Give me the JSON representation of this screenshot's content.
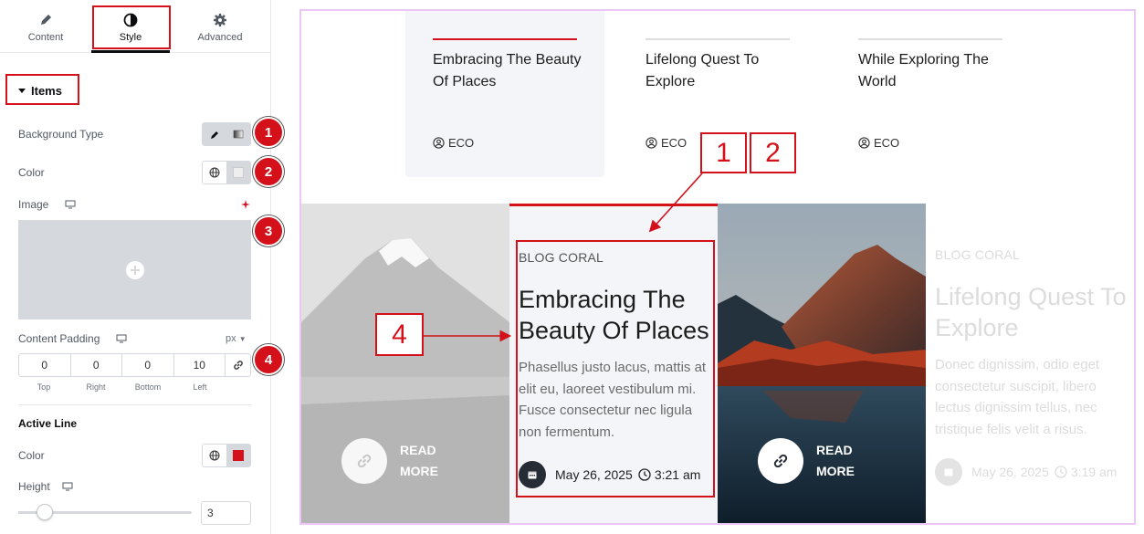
{
  "tabs": [
    {
      "label": "Content",
      "icon": "pencil-icon"
    },
    {
      "label": "Style",
      "icon": "half-circle-icon"
    },
    {
      "label": "Advanced",
      "icon": "gear-icon"
    }
  ],
  "section": {
    "title": "Items"
  },
  "fields": {
    "background_type": "Background Type",
    "color": "Color",
    "image": "Image",
    "content_padding": "Content Padding",
    "unit": "px",
    "padding": {
      "top": "0",
      "right": "0",
      "bottom": "0",
      "left": "10"
    },
    "padding_labels": {
      "top": "Top",
      "right": "Right",
      "bottom": "Bottom",
      "left": "Left"
    },
    "active_line": "Active Line",
    "active_line_color": "Color",
    "height": "Height",
    "height_value": "3",
    "height_fraction": 0.15
  },
  "badges": [
    "1",
    "2",
    "3",
    "4"
  ],
  "colors": {
    "accent": "#d4111a",
    "active_line": "#d4111a"
  },
  "preview": {
    "tab_items": [
      {
        "title": "Embracing The Beauty Of Places",
        "author": "ECO"
      },
      {
        "title": "Lifelong Quest To Explore",
        "author": "ECO"
      },
      {
        "title": "While Exploring The World",
        "author": "ECO"
      }
    ],
    "cards": {
      "read_more_line1": "READ",
      "read_more_line2": "MORE",
      "active": {
        "category": "BLOG CORAL",
        "title": "Embracing The Beauty Of Places",
        "desc": "Phasellus justo lacus, mattis at elit eu, laoreet vestibulum mi. Fusce consectetur nec ligula non fermentum.",
        "date": "May 26, 2025",
        "time": "3:21 am"
      },
      "faded": {
        "category": "BLOG CORAL",
        "title": "Lifelong Quest To Explore",
        "desc": "Donec dignissim, odio eget consectetur suscipit, libero lectus dignissim tellus, nec tristique felis velit a risus.",
        "date": "May 26, 2025",
        "time": "3:19 am"
      }
    },
    "annotations": [
      "1",
      "2",
      "4"
    ]
  }
}
